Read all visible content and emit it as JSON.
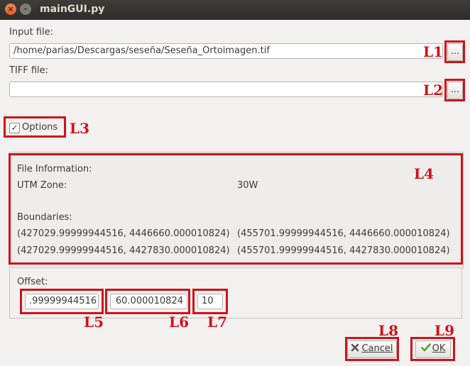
{
  "window": {
    "title": "mainGUI.py",
    "close_glyph": "×",
    "minimize_glyph": "–"
  },
  "input_file": {
    "label": "Input file:",
    "value": "/home/parias/Descargas/seseña/Seseña_Ortoimagen.tif",
    "browse_label": "..."
  },
  "tiff_file": {
    "label": "TIFF file:",
    "value": "",
    "browse_label": "..."
  },
  "options": {
    "label": "Options",
    "checked": true,
    "check_glyph": "✓"
  },
  "file_info": {
    "heading": "File Information:",
    "utm_zone_label": "UTM Zone:",
    "utm_zone_value": "30W",
    "boundaries_label": "Boundaries:",
    "boundaries": [
      "(427029.99999944516, 4446660.000010824)",
      "(455701.99999944516, 4446660.000010824)",
      "(427029.99999944516, 4427830.000010824)",
      "(455701.99999944516, 4427830.000010824)"
    ]
  },
  "offset": {
    "label": "Offset:",
    "x_value": ".99999944516",
    "y_value": "60.000010824",
    "z_value": "10"
  },
  "buttons": {
    "cancel_label": "Cancel",
    "cancel_icon": "cancel-x-icon",
    "ok_label": "OK",
    "ok_icon": "check-icon"
  },
  "annotations": {
    "l1": "L1",
    "l2": "L2",
    "l3": "L3",
    "l4": "L4",
    "l5": "L5",
    "l6": "L6",
    "l7": "L7",
    "l8": "L8",
    "l9": "L9"
  },
  "colors": {
    "annotation": "#d0121b",
    "titlebar": "#2d2c28",
    "window_bg": "#f2f1f0",
    "ok_icon": "#4fa32c"
  }
}
